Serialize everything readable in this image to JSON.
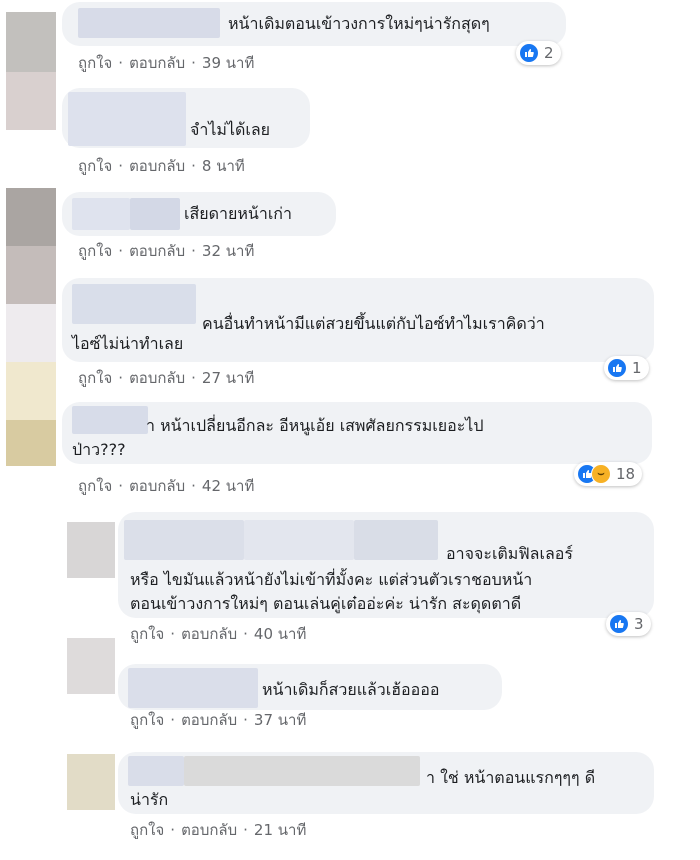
{
  "colors": {
    "bubble_bg": "#f0f2f5",
    "action_text": "#65676b",
    "like_blue": "#1877f2",
    "haha_yellow": "#f7b125"
  },
  "actions": {
    "like": "ถูกใจ",
    "reply": "ตอบกลับ",
    "separator": "·"
  },
  "comments": [
    {
      "line1": "หน้าเดิมตอนเข้าวงการใหม่ๆน่ารักสุดๆ",
      "line2": "",
      "time": "39 นาที",
      "reaction_count": "2",
      "reaction_icons": [
        "like-icon"
      ]
    },
    {
      "line1": "จำไม่ได้เลย",
      "line2": "",
      "time": "8 นาที",
      "reaction_count": "",
      "reaction_icons": []
    },
    {
      "line1": "เสียดายหน้าเก่า",
      "line2": "",
      "time": "32 นาที",
      "reaction_count": "",
      "reaction_icons": []
    },
    {
      "line1": "คนอื่นทำหน้ามีแต่สวยขึ้นแต่กับไอซ์ทำไมเราคิดว่า",
      "line2": "ไอซ์ไม่น่าทำเลย",
      "time": "27 นาที",
      "reaction_count": "1",
      "reaction_icons": [
        "like-icon"
      ]
    },
    {
      "line1": "า หน้าเปลี่ยนอีกละ อีหนูเอ้ย เสพศัลยกรรมเยอะไป",
      "line2": "ป่าว???",
      "time": "42 นาที",
      "reaction_count": "18",
      "reaction_icons": [
        "like-icon",
        "haha-icon"
      ]
    }
  ],
  "replies": [
    {
      "line1": "อาจจะเติมฟิลเลอร์",
      "line2": "หรือ ไขมันแล้วหน้ายังไม่เข้าที่มั้งคะ แต่ส่วนตัวเราชอบหน้า",
      "line3": "ตอนเข้าวงการใหม่ๆ ตอนเล่นคู่เต๋ออ่ะค่ะ น่ารัก สะดุดตาดี",
      "time": "40 นาที",
      "reaction_count": "3",
      "reaction_icons": [
        "like-icon"
      ]
    },
    {
      "line1": "หน้าเดิมก็สวยแล้วเฮ้ออออ",
      "line2": "",
      "line3": "",
      "time": "37 นาที",
      "reaction_count": "",
      "reaction_icons": []
    },
    {
      "line1": "า ใช่ หน้าตอนแรกๆๆๆ ดี",
      "line2": "น่ารัก",
      "line3": "",
      "time": "21 นาที",
      "reaction_count": "",
      "reaction_icons": []
    }
  ]
}
